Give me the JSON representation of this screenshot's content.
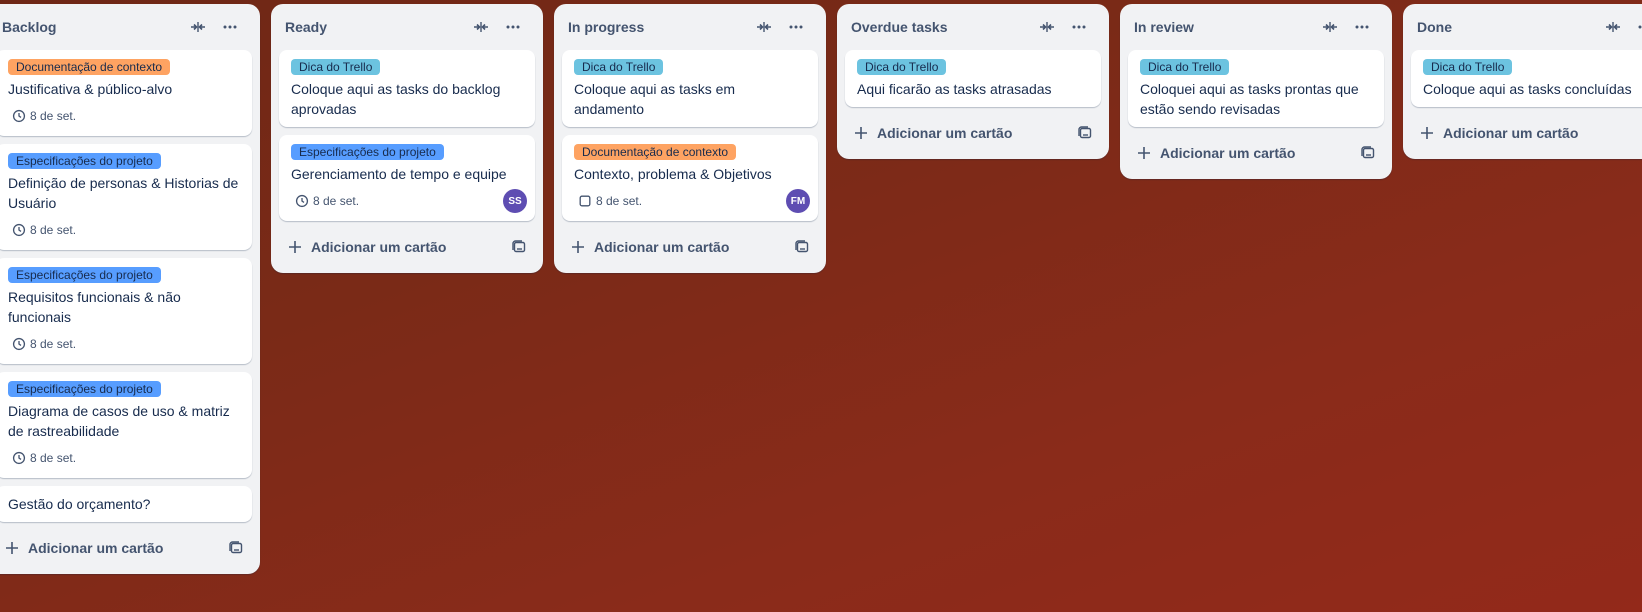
{
  "board": {
    "lists": [
      {
        "title": "Backlog",
        "add_label": "Adicionar um cartão",
        "cards": [
          {
            "label": "Documentação de contexto",
            "label_color": "orange",
            "title": "Justificativa & público-alvo",
            "date": "8 de set."
          },
          {
            "label": "Especificações do projeto",
            "label_color": "blue",
            "title": "Definição de personas & Historias de Usuário",
            "date": "8 de set."
          },
          {
            "label": "Especificações do projeto",
            "label_color": "blue",
            "title": "Requisitos funcionais & não funcionais",
            "date": "8 de set."
          },
          {
            "label": "Especificações do projeto",
            "label_color": "blue",
            "title": "Diagrama de casos de uso & matriz de rastreabilidade",
            "date": "8 de set."
          },
          {
            "title": "Gestão do orçamento?"
          }
        ]
      },
      {
        "title": "Ready",
        "add_label": "Adicionar um cartão",
        "cards": [
          {
            "label": "Dica do Trello",
            "label_color": "teal",
            "title": "Coloque aqui as tasks do backlog aprovadas"
          },
          {
            "label": "Especificações do projeto",
            "label_color": "blue",
            "title": "Gerenciamento de tempo e equipe",
            "date": "8 de set.",
            "avatar": "SS"
          }
        ]
      },
      {
        "title": "In progress",
        "add_label": "Adicionar um cartão",
        "cards": [
          {
            "label": "Dica do Trello",
            "label_color": "teal",
            "title": "Coloque aqui as tasks em andamento"
          },
          {
            "label": "Documentação de contexto",
            "label_color": "orange",
            "title": "Contexto, problema & Objetivos",
            "date": "8 de set.",
            "avatar": "FM"
          }
        ]
      },
      {
        "title": "Overdue tasks",
        "add_label": "Adicionar um cartão",
        "cards": [
          {
            "label": "Dica do Trello",
            "label_color": "teal",
            "title": "Aqui ficarão as tasks atrasadas"
          }
        ]
      },
      {
        "title": "In review",
        "add_label": "Adicionar um cartão",
        "cards": [
          {
            "label": "Dica do Trello",
            "label_color": "teal",
            "title": "Coloquei aqui as tasks prontas que estão sendo revisadas"
          }
        ]
      },
      {
        "title": "Done",
        "add_label": "Adicionar um cartão",
        "cards": [
          {
            "label": "Dica do Trello",
            "label_color": "teal",
            "title": "Coloque aqui as tasks concluídas"
          }
        ]
      }
    ]
  },
  "icons": {
    "collapse": "collapse-list-icon",
    "more": "more-options-icon",
    "clock": "clock-icon",
    "checkbox": "checkbox-icon",
    "plus": "plus-icon",
    "template": "card-template-icon"
  },
  "colors": {
    "orange": "#fea362",
    "blue": "#579dff",
    "teal": "#6cc3e0",
    "avatar": "#5e4db2"
  }
}
